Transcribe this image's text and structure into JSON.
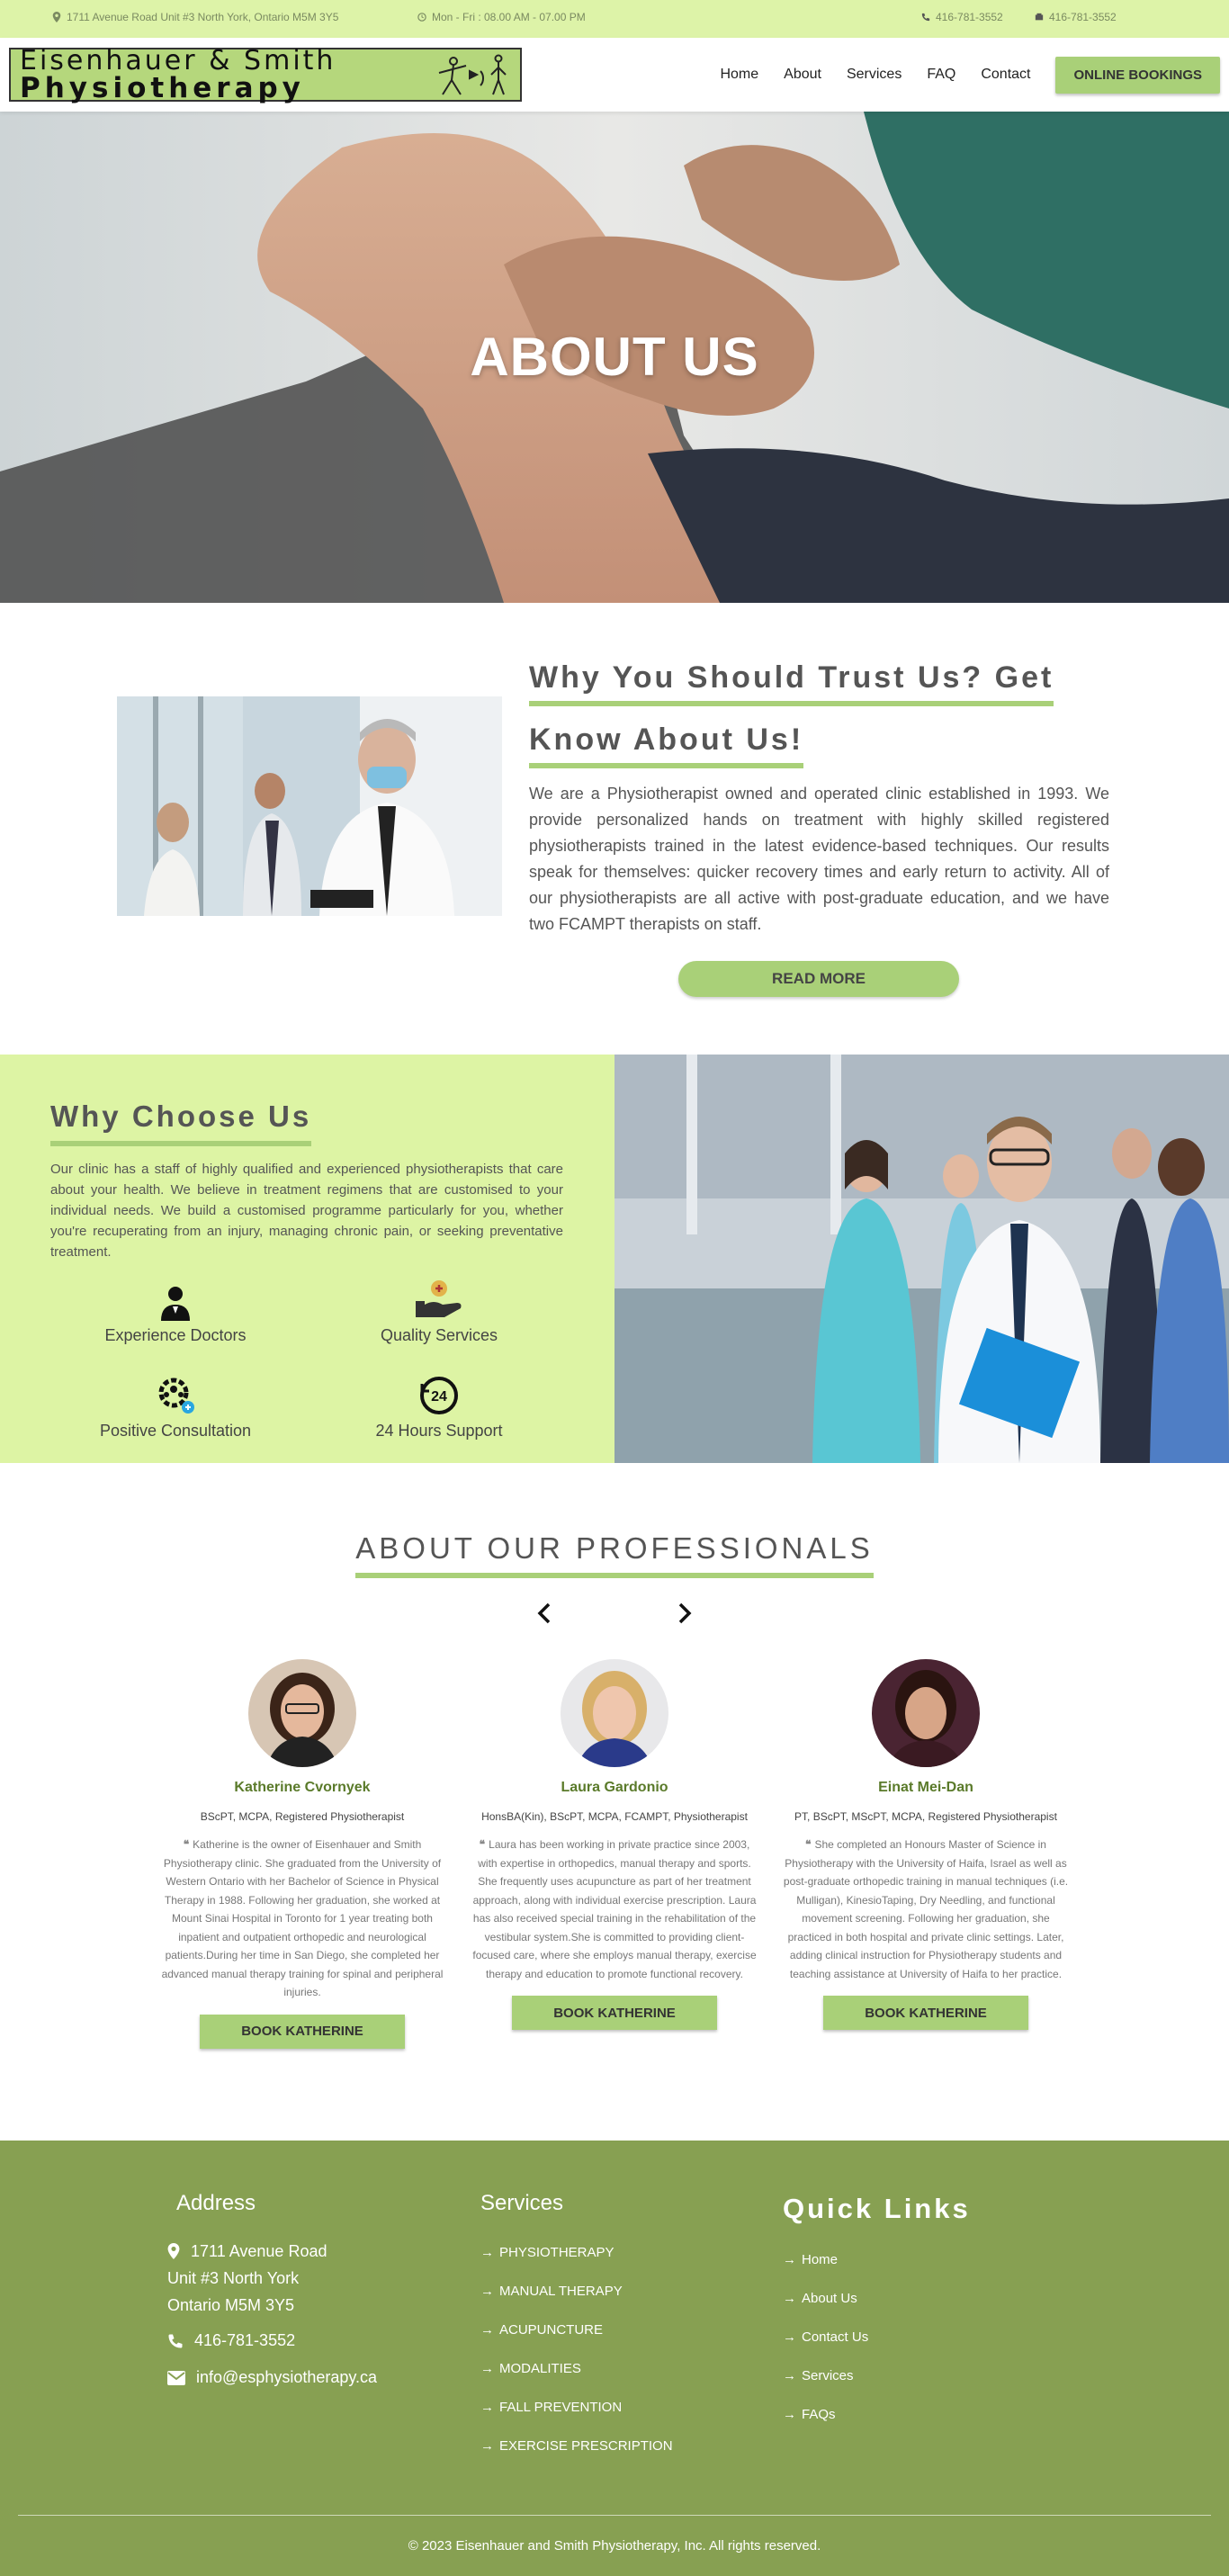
{
  "topbar": {
    "address": "1711 Avenue Road Unit #3 North York, Ontario M5M 3Y5",
    "hours": "Mon - Fri : 08.00 AM - 07.00 PM",
    "phone": "416-781-3552",
    "fax": "416-781-3552"
  },
  "logo": {
    "line1": "Eisenhauer & Smith",
    "line2": "Physiotherapy"
  },
  "nav": {
    "items": [
      "Home",
      "About",
      "Services",
      "FAQ",
      "Contact"
    ],
    "cta": "ONLINE BOOKINGS"
  },
  "hero": {
    "title": "ABOUT US"
  },
  "trust": {
    "title_line1": "Why You Should Trust Us? Get",
    "title_line2": "Know About Us!",
    "paragraph": "We are a Physiotherapist owned and operated clinic established in 1993. We provide personalized hands on treatment with highly skilled registered physiotherapists trained in the latest evidence-based techniques. Our results speak for themselves: quicker recovery times and early return to activity. All of our physiotherapists are all active with post-graduate education, and we have two FCAMPT therapists on staff.",
    "button": "READ MORE"
  },
  "why": {
    "title": "Why Choose Us",
    "paragraph": "Our clinic has a staff of highly qualified and experienced physiotherapists that care about your health. We believe in treatment regimens that are customised to your individual needs. We build a customised programme particularly for you, whether you're recuperating from an injury, managing chronic pain, or seeking preventative treatment.",
    "features": [
      {
        "label": "Experience Doctors",
        "icon": "doctor-icon"
      },
      {
        "label": "Quality Services",
        "icon": "hand-plus-icon"
      },
      {
        "label": "Positive Consultation",
        "icon": "team-gear-icon"
      },
      {
        "label": "24 Hours Support",
        "icon": "clock-24-icon"
      }
    ]
  },
  "professionals": {
    "title": "ABOUT OUR PROFESSIONALS",
    "cards": [
      {
        "name": "Katherine Cvornyek",
        "credentials": "BScPT, MCPA, Registered Physiotherapist",
        "bio": "Katherine is the owner of Eisenhauer and Smith Physiotherapy clinic. She graduated from the University of Western Ontario with her Bachelor of Science in Physical Therapy in 1988. Following her graduation, she worked at Mount Sinai Hospital in Toronto for 1 year treating both inpatient and outpatient orthopedic and neurological patients.During her time in San Diego, she completed her advanced manual therapy training for spinal and peripheral injuries.",
        "button": "BOOK KATHERINE"
      },
      {
        "name": "Laura Gardonio",
        "credentials": "HonsBA(Kin), BScPT, MCPA, FCAMPT, Physiotherapist",
        "bio": "Laura has been working in private practice since 2003, with expertise in orthopedics, manual therapy and sports. She frequently uses acupuncture as part of her treatment approach, along with individual exercise prescription. Laura has also received special training in the rehabilitation of the vestibular system.She is committed to providing client-focused care, where she employs manual therapy, exercise therapy and education to promote functional recovery.",
        "button": "BOOK KATHERINE"
      },
      {
        "name": "Einat Mei-Dan",
        "credentials": "PT, BScPT, MScPT, MCPA, Registered Physiotherapist",
        "bio": "She completed an Honours Master of Science in Physiotherapy with the University of Haifa, Israel as well as post-graduate orthopedic training in manual techniques (i.e. Mulligan), KinesioTaping, Dry Needling, and functional movement screening. Following her graduation, she practiced in both hospital and private clinic settings. Later, adding clinical instruction for Physiotherapy students and teaching assistance at University of Haifa to her practice.",
        "button": "BOOK KATHERINE"
      }
    ]
  },
  "footer": {
    "address_title": "Address",
    "address_lines": [
      "1711 Avenue Road",
      "Unit #3 North York",
      "Ontario M5M 3Y5"
    ],
    "phone": "416-781-3552",
    "email": "info@esphysiotherapy.ca",
    "services_title": "Services",
    "services": [
      "PHYSIOTHERAPY",
      "MANUAL THERAPY",
      "ACUPUNCTURE",
      "MODALITIES",
      "FALL PREVENTION",
      "EXERCISE PRESCRIPTION"
    ],
    "links_title": "Quick Links",
    "links": [
      "Home",
      "About Us",
      "Contact Us",
      "Services",
      "FAQs"
    ],
    "copyright": "© 2023 Eisenhauer and Smith Physiotherapy, Inc. All rights reserved."
  }
}
